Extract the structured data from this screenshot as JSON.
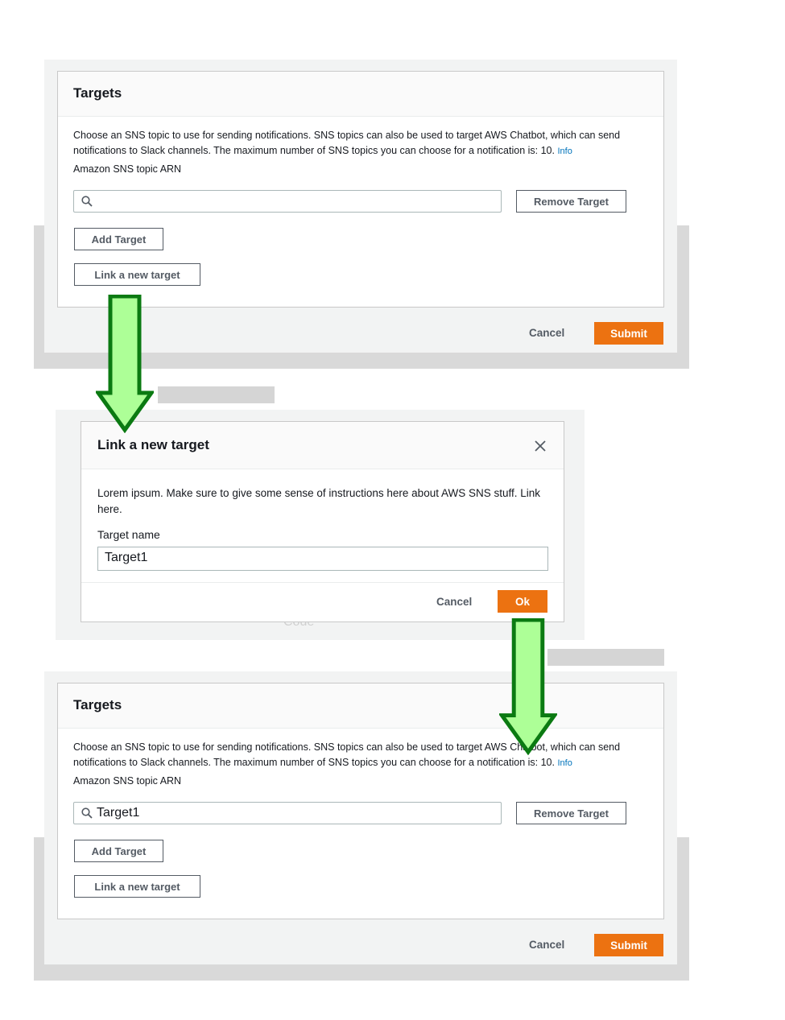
{
  "panel1": {
    "title": "Targets",
    "description": "Choose an SNS topic to use for sending notifications. SNS topics can also be used to target AWS Chatbot, which can send notifications to Slack channels. The maximum number of SNS topics you can choose for a notification is: 10.",
    "info": "Info",
    "arn_label": "Amazon SNS topic ARN",
    "search_value": "",
    "remove_target": "Remove Target",
    "add_target": "Add Target",
    "link_new_target": "Link a new target",
    "cancel": "Cancel",
    "submit": "Submit"
  },
  "modal": {
    "title": "Link a new target",
    "description": "Lorem ipsum. Make sure to give some sense of instructions here about AWS SNS stuff. Link here.",
    "field_label": "Target name",
    "field_value": "Target1",
    "cancel": "Cancel",
    "ok": "Ok"
  },
  "panel2": {
    "title": "Targets",
    "description": "Choose an SNS topic to use for sending notifications. SNS topics can also be used to target AWS Chatbot, which can send notifications to Slack channels. The maximum number of SNS topics you can choose for a notification is: 10.",
    "info": "Info",
    "arn_label": "Amazon SNS topic ARN",
    "search_value": "Target1",
    "remove_target": "Remove Target",
    "add_target": "Add Target",
    "link_new_target": "Link a new target",
    "cancel": "Cancel",
    "submit": "Submit"
  },
  "icons": {
    "search": "search-icon",
    "close": "close-icon",
    "arrow": "arrow-down-icon"
  },
  "colors": {
    "primary": "#ec7211",
    "arrow_fill": "#adff97",
    "arrow_stroke": "#0b7a12",
    "link": "#0073bb"
  }
}
